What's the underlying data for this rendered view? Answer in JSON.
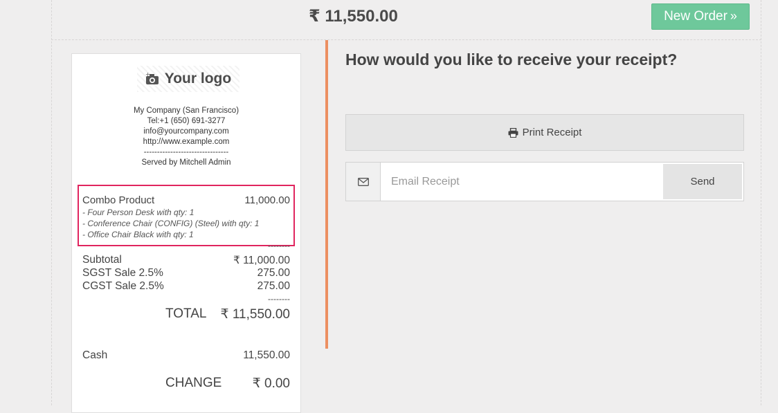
{
  "header": {
    "total_amount": "₹ 11,550.00",
    "new_order_label": "New Order",
    "new_order_icon": "double-chevron-right-icon"
  },
  "receipt": {
    "logo_text": "Your logo",
    "company_lines": [
      "My Company (San Francisco)",
      "Tel:+1 (650) 691-3277",
      "info@yourcompany.com",
      "http://www.example.com",
      "--------------------------------",
      "Served by Mitchell Admin"
    ],
    "line_item": {
      "name": "Combo Product",
      "price": "11,000.00",
      "components": [
        "- Four Person Desk with qty: 1",
        "- Conference Chair (CONFIG) (Steel) with qty: 1",
        "- Office Chair Black with qty: 1"
      ]
    },
    "dash_sep_1": "--------",
    "subtotal_label": "Subtotal",
    "subtotal_value": "₹ 11,000.00",
    "tax1_label": "SGST Sale 2.5%",
    "tax1_value": "275.00",
    "tax2_label": "CGST Sale 2.5%",
    "tax2_value": "275.00",
    "dash_sep_2": "--------",
    "total_label": "TOTAL",
    "total_value": "₹ 11,550.00",
    "payment_label": "Cash",
    "payment_value": "11,550.00",
    "change_label": "CHANGE",
    "change_value": "₹ 0.00"
  },
  "receipt_options": {
    "question": "How would you like to receive your receipt?",
    "print_label": "Print Receipt",
    "email_placeholder": "Email Receipt",
    "send_label": "Send"
  },
  "colors": {
    "background": "#efeeee",
    "new_order_green": "#6ec89b",
    "divider_orange": "#ec8f61",
    "highlight_red": "#e0245e"
  }
}
